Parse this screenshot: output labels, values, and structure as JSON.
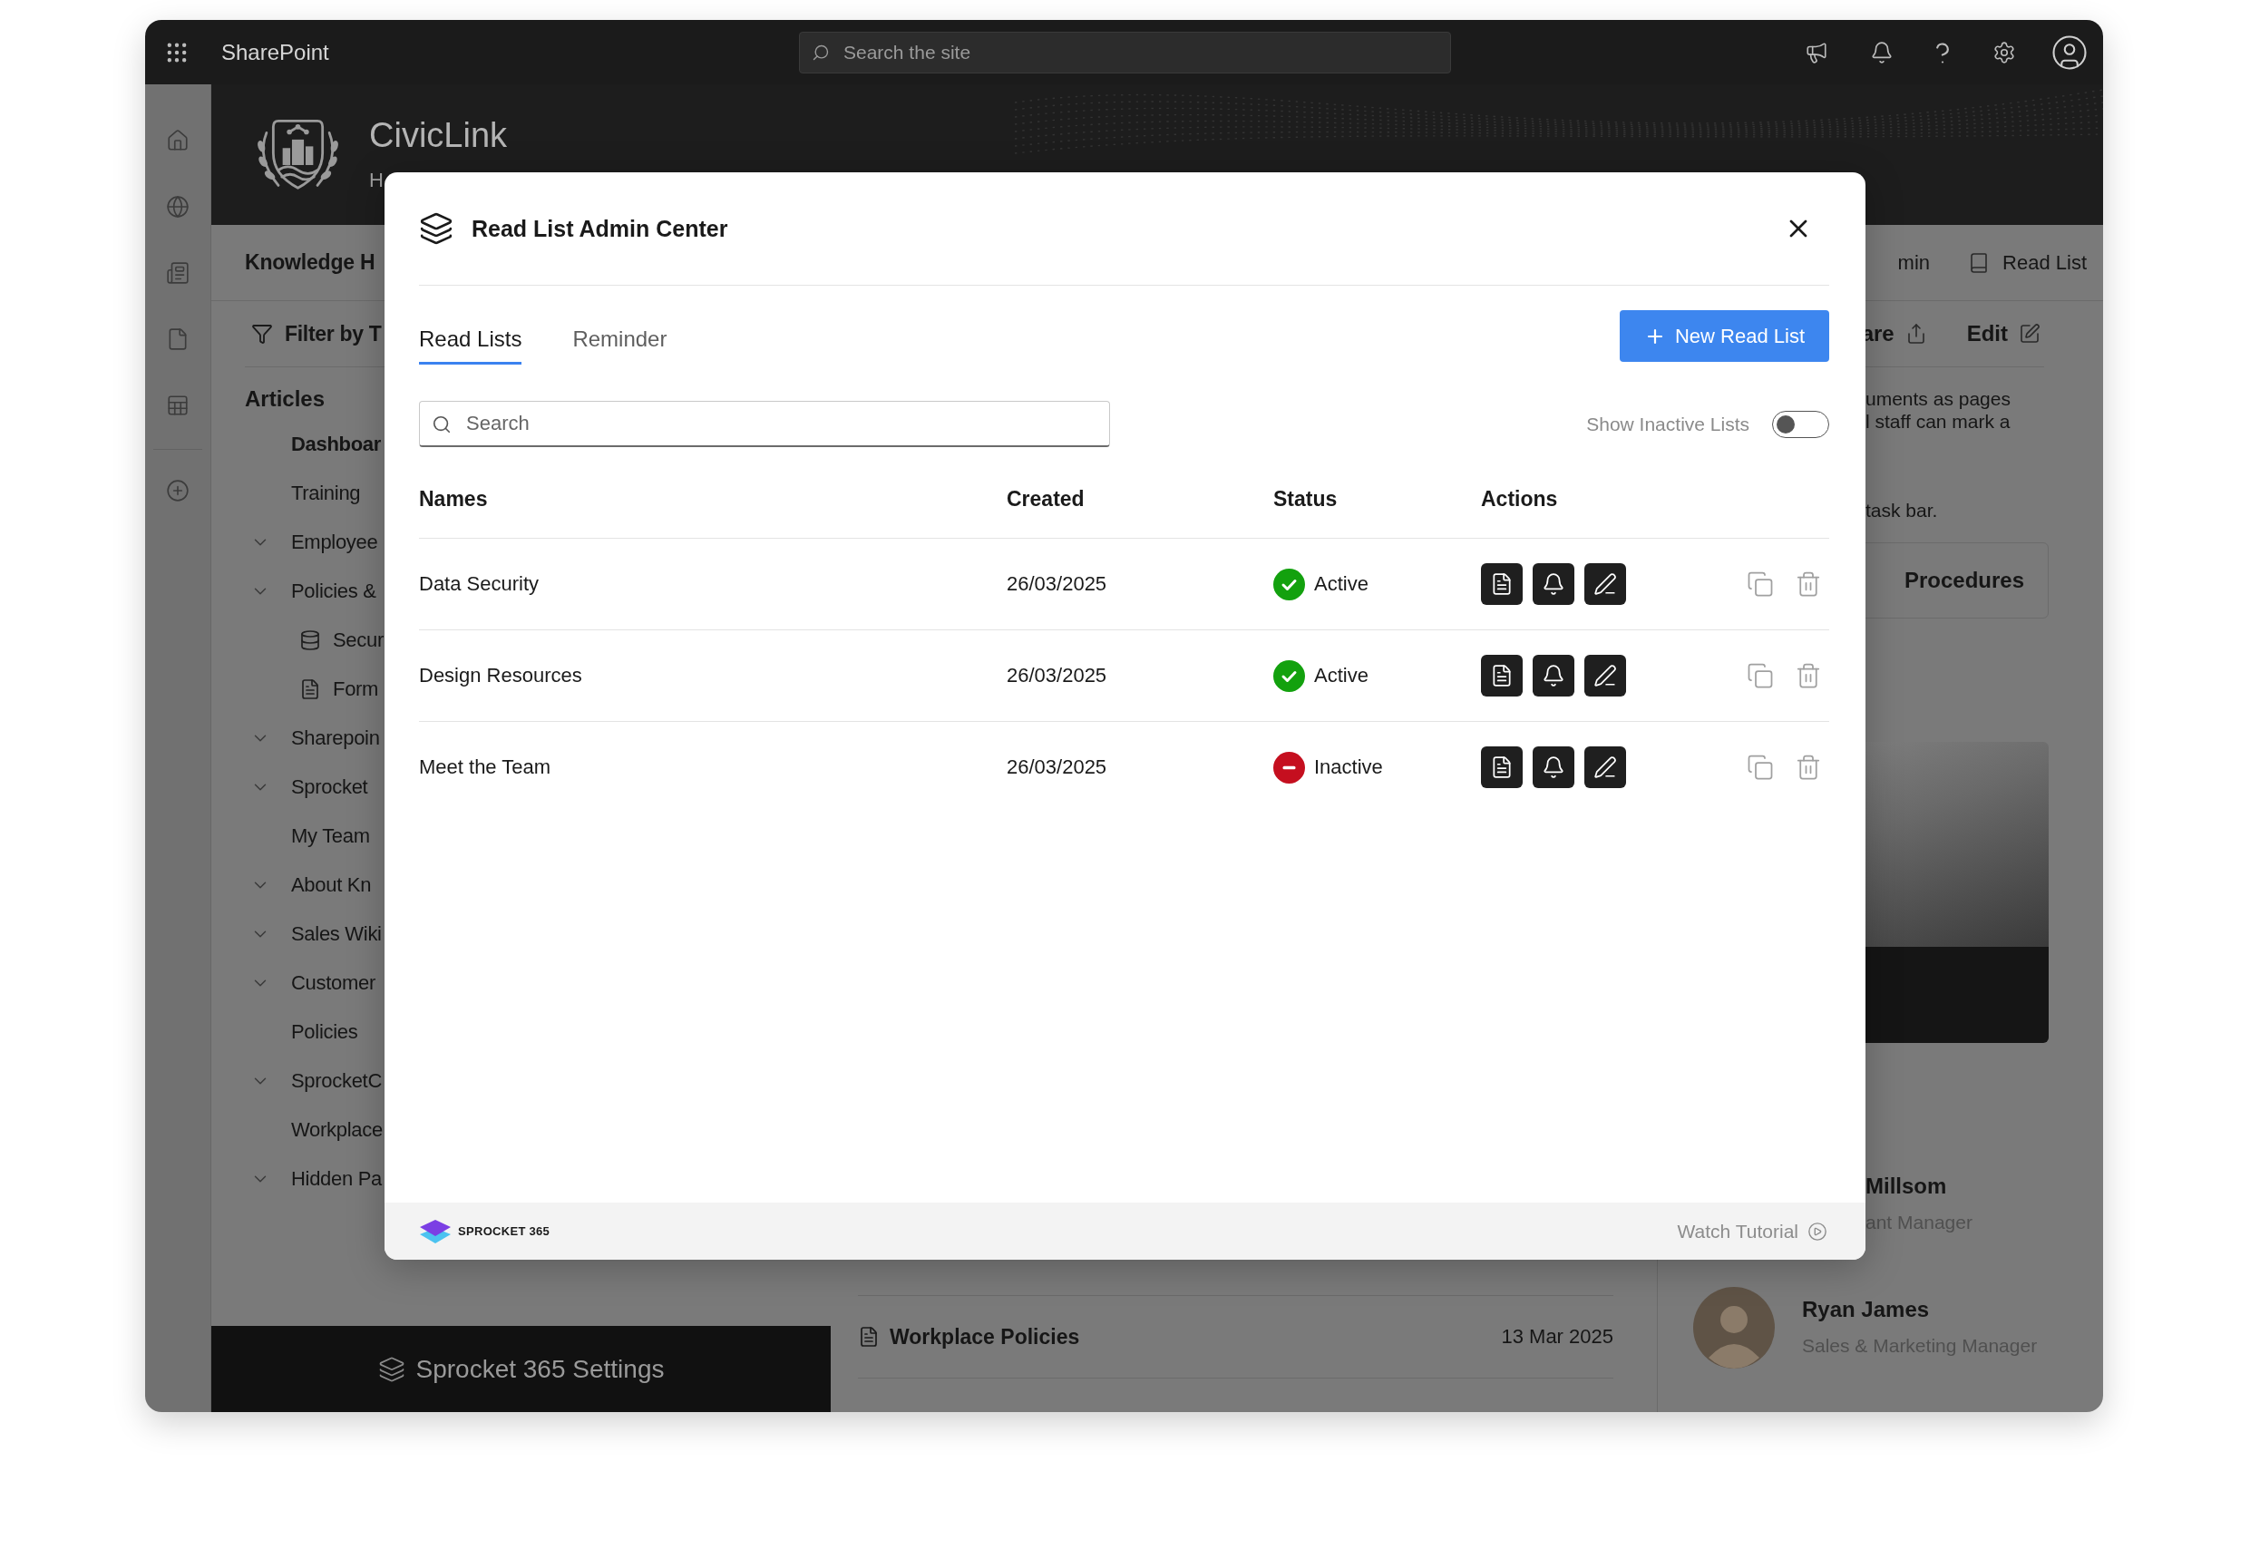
{
  "top_bar": {
    "app_name": "SharePoint",
    "search": {
      "placeholder": "Search the site"
    }
  },
  "site_header": {
    "title": "CivicLink",
    "subtitle": "H"
  },
  "site_nav": {
    "title": "Knowledge H",
    "links": [
      {
        "label": "min",
        "kind": "text"
      },
      {
        "label": "Read List",
        "kind": "icon"
      }
    ]
  },
  "toolbar": {
    "filter": "Filter by T",
    "actions": [
      {
        "label": "are",
        "kind": "share"
      },
      {
        "label": "Edit",
        "kind": "edit"
      }
    ]
  },
  "sidebar": {
    "heading": "Articles",
    "items": [
      {
        "label": "Dashboar",
        "selected": true,
        "collapsible": false
      },
      {
        "label": "Training",
        "selected": false,
        "collapsible": false
      },
      {
        "label": "Employee",
        "selected": false,
        "collapsible": true
      },
      {
        "label": "Policies &",
        "selected": false,
        "collapsible": true,
        "children": [
          {
            "label": "Secur",
            "kind": "list",
            "selected": false
          },
          {
            "label": "Form",
            "kind": "page",
            "selected": false
          }
        ]
      },
      {
        "label": "Sharepoin",
        "selected": false,
        "collapsible": true
      },
      {
        "label": "Sprocket",
        "selected": false,
        "collapsible": true
      },
      {
        "label": "My Team",
        "selected": false,
        "collapsible": false
      },
      {
        "label": "About Kn",
        "selected": false,
        "collapsible": true
      },
      {
        "label": "Sales Wiki",
        "selected": false,
        "collapsible": true
      },
      {
        "label": "Customer",
        "selected": false,
        "collapsible": true
      },
      {
        "label": "Policies",
        "selected": false,
        "collapsible": false
      },
      {
        "label": "SprocketC",
        "selected": false,
        "collapsible": true
      },
      {
        "label": "Workplace",
        "selected": false,
        "collapsible": false
      },
      {
        "label": "Hidden Pa",
        "selected": false,
        "collapsible": true
      }
    ]
  },
  "settings_bar": {
    "label": "Sprocket 365 Settings"
  },
  "page_list": {
    "rows": [
      {
        "title": "Workplace Policies",
        "date": "13 Mar 2025"
      }
    ]
  },
  "right_panel": {
    "paragraphs": [
      [
        "uments as pages",
        "l staff can mark a"
      ],
      [
        "task bar."
      ]
    ],
    "tile": "Procedures",
    "people": [
      {
        "name": "Millsom",
        "role": "ant Manager",
        "avatar": false
      },
      {
        "name": "Ryan James",
        "role": "Sales & Marketing Manager",
        "avatar": true
      }
    ]
  },
  "dialog": {
    "title": "Read List Admin Center",
    "tabs": [
      {
        "label": "Read Lists",
        "selected": true
      },
      {
        "label": "Reminder",
        "selected": false
      }
    ],
    "new_button": "New Read List",
    "search": {
      "placeholder": "Search"
    },
    "inactive_toggle": {
      "label": "Show Inactive Lists",
      "on": false
    },
    "table": {
      "columns": [
        "Names",
        "Created",
        "Status",
        "Actions"
      ],
      "rows": [
        {
          "name": "Data Security",
          "created": "26/03/2025",
          "status": "Active",
          "active": true
        },
        {
          "name": "Design Resources",
          "created": "26/03/2025",
          "status": "Active",
          "active": true
        },
        {
          "name": "Meet the Team",
          "created": "26/03/2025",
          "status": "Inactive",
          "active": false
        }
      ]
    },
    "footer": {
      "brand": "SPROCKET 365",
      "link": "Watch Tutorial"
    }
  }
}
